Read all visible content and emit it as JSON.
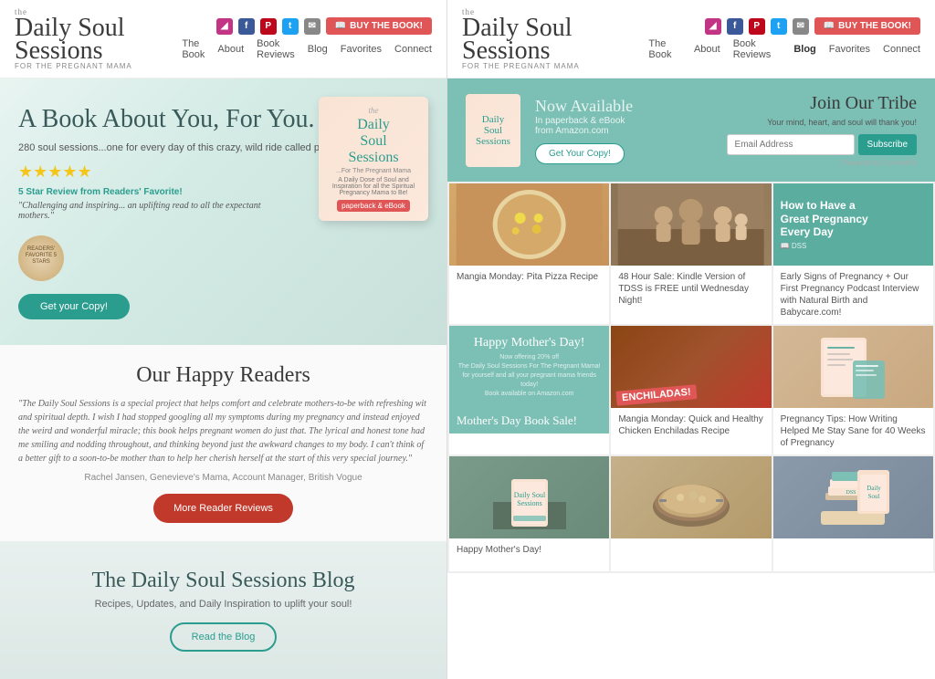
{
  "site": {
    "name": "Daily Soul Sessions",
    "tagline": "FOR THE PREGNANT MAMA"
  },
  "nav": {
    "items": [
      {
        "label": "The Book",
        "active": false
      },
      {
        "label": "About",
        "active": false
      },
      {
        "label": "Book Reviews",
        "active": false
      },
      {
        "label": "Blog",
        "active": true
      },
      {
        "label": "Favorites",
        "active": false
      },
      {
        "label": "Connect",
        "active": false
      }
    ]
  },
  "header": {
    "buy_button": "BUY THE BOOK!"
  },
  "hero": {
    "title": "A Book About You, For You.",
    "subtitle": "280 soul sessions...one for every day of this crazy, wild ride called pregnancy!",
    "review_label": "5 Star Review from Readers' Favorite!",
    "review_quote": "\"Challenging and inspiring... an uplifting read to all the expectant mothers.\"",
    "cta": "Get your Copy!",
    "book_title": "Daily Soul Sessions",
    "book_subtitle": "...For The Pregnant Mama",
    "book_badge": "paperback & eBook"
  },
  "readers": {
    "title": "Our Happy Readers",
    "quote": "\"The Daily Soul Sessions is a special project that helps comfort and celebrate mothers-to-be with refreshing wit and spiritual depth. I wish I had stopped googling all my symptoms during my pregnancy and instead enjoyed the weird and wonderful miracle; this book helps pregnant women do just that. The lyrical and honest tone had me smiling and nodding throughout, and thinking beyond just the awkward changes to my body. I can't think of a better gift to a soon-to-be mother than to help her cherish herself at the start of this very special journey.\"",
    "attribution": "Rachel Jansen, Genevieve's Mama, Account Manager, British Vogue",
    "cta": "More Reader Reviews"
  },
  "blog_promo": {
    "title": "The Daily Soul Sessions Blog",
    "subtitle": "Recipes, Updates, and Daily Inspiration to uplift your soul!",
    "cta": "Read the Blog"
  },
  "newsletter": {
    "available_label": "Now Available",
    "desc": "In paperback & eBook\nfrom Amazon.com",
    "cta": "Get Your Copy!",
    "join_title": "Join Our Tribe",
    "join_sub": "Your mind, heart, and soul will thank you!",
    "email_placeholder": "Email Address",
    "subscribe_label": "Subscribe",
    "powered_by": "Powered by ConvertKit"
  },
  "blog_posts": [
    {
      "id": 1,
      "img_type": "food",
      "caption": "Mangia Monday: Pita Pizza Recipe"
    },
    {
      "id": 2,
      "img_type": "family",
      "caption": "48 Hour Sale: Kindle Version of TDSS is FREE until Wednesday Night!"
    },
    {
      "id": 3,
      "img_type": "teal_overlay",
      "caption": "How to Have a Great Pregnancy Every Day",
      "overlay_sub": "Early Signs of Pregnancy + Our First Pregnancy Podcast Interview with Natural Birth and Babycare.com!"
    },
    {
      "id": 4,
      "img_type": "mothers_day",
      "caption": "Mother's Day Book Sale!"
    },
    {
      "id": 5,
      "img_type": "enchiladas",
      "caption": "Mangia Monday: Quick and Healthy Chicken Enchiladas Recipe"
    },
    {
      "id": 6,
      "img_type": "pregnancy_book",
      "caption": "Pregnancy Tips: How Writing Helped Me Stay Sane for 40 Weeks of Pregnancy"
    },
    {
      "id": 7,
      "img_type": "book_table",
      "caption": "Happy Mother's Day!"
    },
    {
      "id": 8,
      "img_type": "casserole",
      "caption": ""
    },
    {
      "id": 9,
      "img_type": "book_stack",
      "caption": ""
    }
  ]
}
